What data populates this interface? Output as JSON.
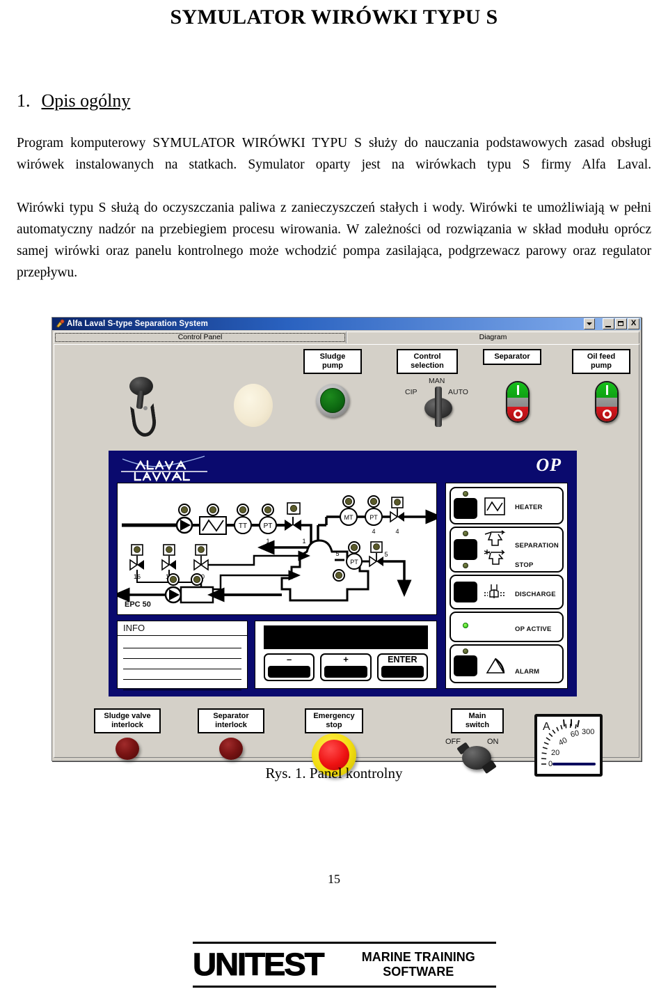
{
  "document": {
    "title": "SYMULATOR WIRÓWKI TYPU S",
    "section_number": "1.",
    "section_title": "Opis ogólny",
    "paragraph_1": "Program komputerowy SYMULATOR WIRÓWKI TYPU S służy do nauczania podstawowych zasad obsługi wirówek instalowanych na statkach. Symulator oparty jest na wirówkach typu S firmy Alfa Laval.",
    "paragraph_2": "Wirówki typu S służą do oczyszczania paliwa z zanieczyszczeń stałych i wody. Wirówki te umożliwiają w pełni automatyczny nadzór na przebiegiem procesu wirowania. W zależności od rozwiązania w skład modułu oprócz samej wirówki oraz panelu kontrolnego może wchodzić pompa zasilająca, podgrzewacz parowy oraz regulator przepływu.",
    "figure_caption": "Rys. 1. Panel kontrolny",
    "page_number": "15"
  },
  "footer": {
    "brand": "UNITEST",
    "tagline": "MARINE TRAINING\nSOFTWARE"
  },
  "window": {
    "title": "Alfa Laval S-type Separation System",
    "icon": "app-icon",
    "buttons": {
      "dropdown": "▾",
      "minimize": "_",
      "maximize": "□",
      "close": "X"
    },
    "tabs": [
      {
        "label": "Control Panel",
        "active": true
      },
      {
        "label": "Diagram",
        "active": false
      }
    ]
  },
  "control_panel": {
    "top_controls": [
      {
        "name": "sludge-pump",
        "label": "Sludge\npump",
        "type": "push-button",
        "state": "green"
      },
      {
        "name": "control-selection",
        "label": "Control\nselection",
        "type": "rotary-3pos",
        "positions": [
          "CIP",
          "MAN",
          "AUTO"
        ],
        "selected": "MAN"
      },
      {
        "name": "separator",
        "label": "Separator",
        "type": "rocker",
        "on_symbol": "I",
        "off_symbol": "O"
      },
      {
        "name": "oil-feed-pump",
        "label": "Oil feed\npump",
        "type": "rocker",
        "on_symbol": "I",
        "off_symbol": "O"
      }
    ],
    "bottom_controls": [
      {
        "name": "sludge-valve-interlock",
        "label": "Sludge valve\ninterlock",
        "type": "indicator-lamp",
        "state": "dark-red"
      },
      {
        "name": "separator-interlock",
        "label": "Separator\ninterlock",
        "type": "indicator-lamp",
        "state": "dark-red"
      },
      {
        "name": "emergency-stop",
        "label": "Emergency\nstop",
        "type": "mushroom-button",
        "state": "red"
      },
      {
        "name": "main-switch",
        "label": "Main\nswitch",
        "type": "rotary-2pos",
        "positions": [
          "OFF",
          "ON"
        ],
        "selected": "OFF"
      }
    ],
    "ammeter": {
      "unit": "A",
      "ticks": [
        "0",
        "20",
        "40",
        "60",
        "300"
      ],
      "value": "0"
    }
  },
  "diagram": {
    "brand_logo": "ALFA LAVAL",
    "op_label": "OP",
    "epc_label": "EPC 50",
    "info_panel": {
      "header": "INFO",
      "line_count": 5
    },
    "keypad": {
      "display": "",
      "keys": [
        {
          "name": "minus-key",
          "label": "–"
        },
        {
          "name": "plus-key",
          "label": "+"
        },
        {
          "name": "enter-key",
          "label": "ENTER"
        }
      ]
    },
    "op_rows": [
      {
        "name": "heater",
        "label": "HEATER",
        "led": "off",
        "has_button": true,
        "symbol": "heater-icon"
      },
      {
        "name": "separation",
        "label": "SEPARATION",
        "label2": "STOP",
        "led": "off",
        "led2": "off",
        "has_button": true,
        "symbol": "separation-icon"
      },
      {
        "name": "discharge",
        "label": "DISCHARGE",
        "led": "none",
        "has_button": true,
        "symbol": "discharge-icon"
      },
      {
        "name": "op-active",
        "label": "OP ACTIVE",
        "led": "on",
        "has_button": false,
        "symbol": "none"
      },
      {
        "name": "alarm",
        "label": "ALARM",
        "led": "off",
        "has_button": true,
        "symbol": "alarm-icon"
      }
    ],
    "flow_instruments": [
      {
        "tag": "TT",
        "number": ""
      },
      {
        "tag": "PT",
        "number": "1"
      },
      {
        "tag": "MT",
        "number": ""
      },
      {
        "tag": "PT",
        "number": "4"
      },
      {
        "tag": "PT",
        "number": "5"
      }
    ],
    "valve_numbers": [
      "1",
      "4",
      "5",
      "16",
      "15",
      "10"
    ]
  },
  "colors": {
    "title_bar_dark": "#0a246a",
    "panel_face": "#d4d0c8",
    "diagram_blue": "#0a0a6e",
    "led_green": "#16c01a",
    "lamp_red": "#d8181f",
    "estop_yellow": "#f2dd10"
  }
}
